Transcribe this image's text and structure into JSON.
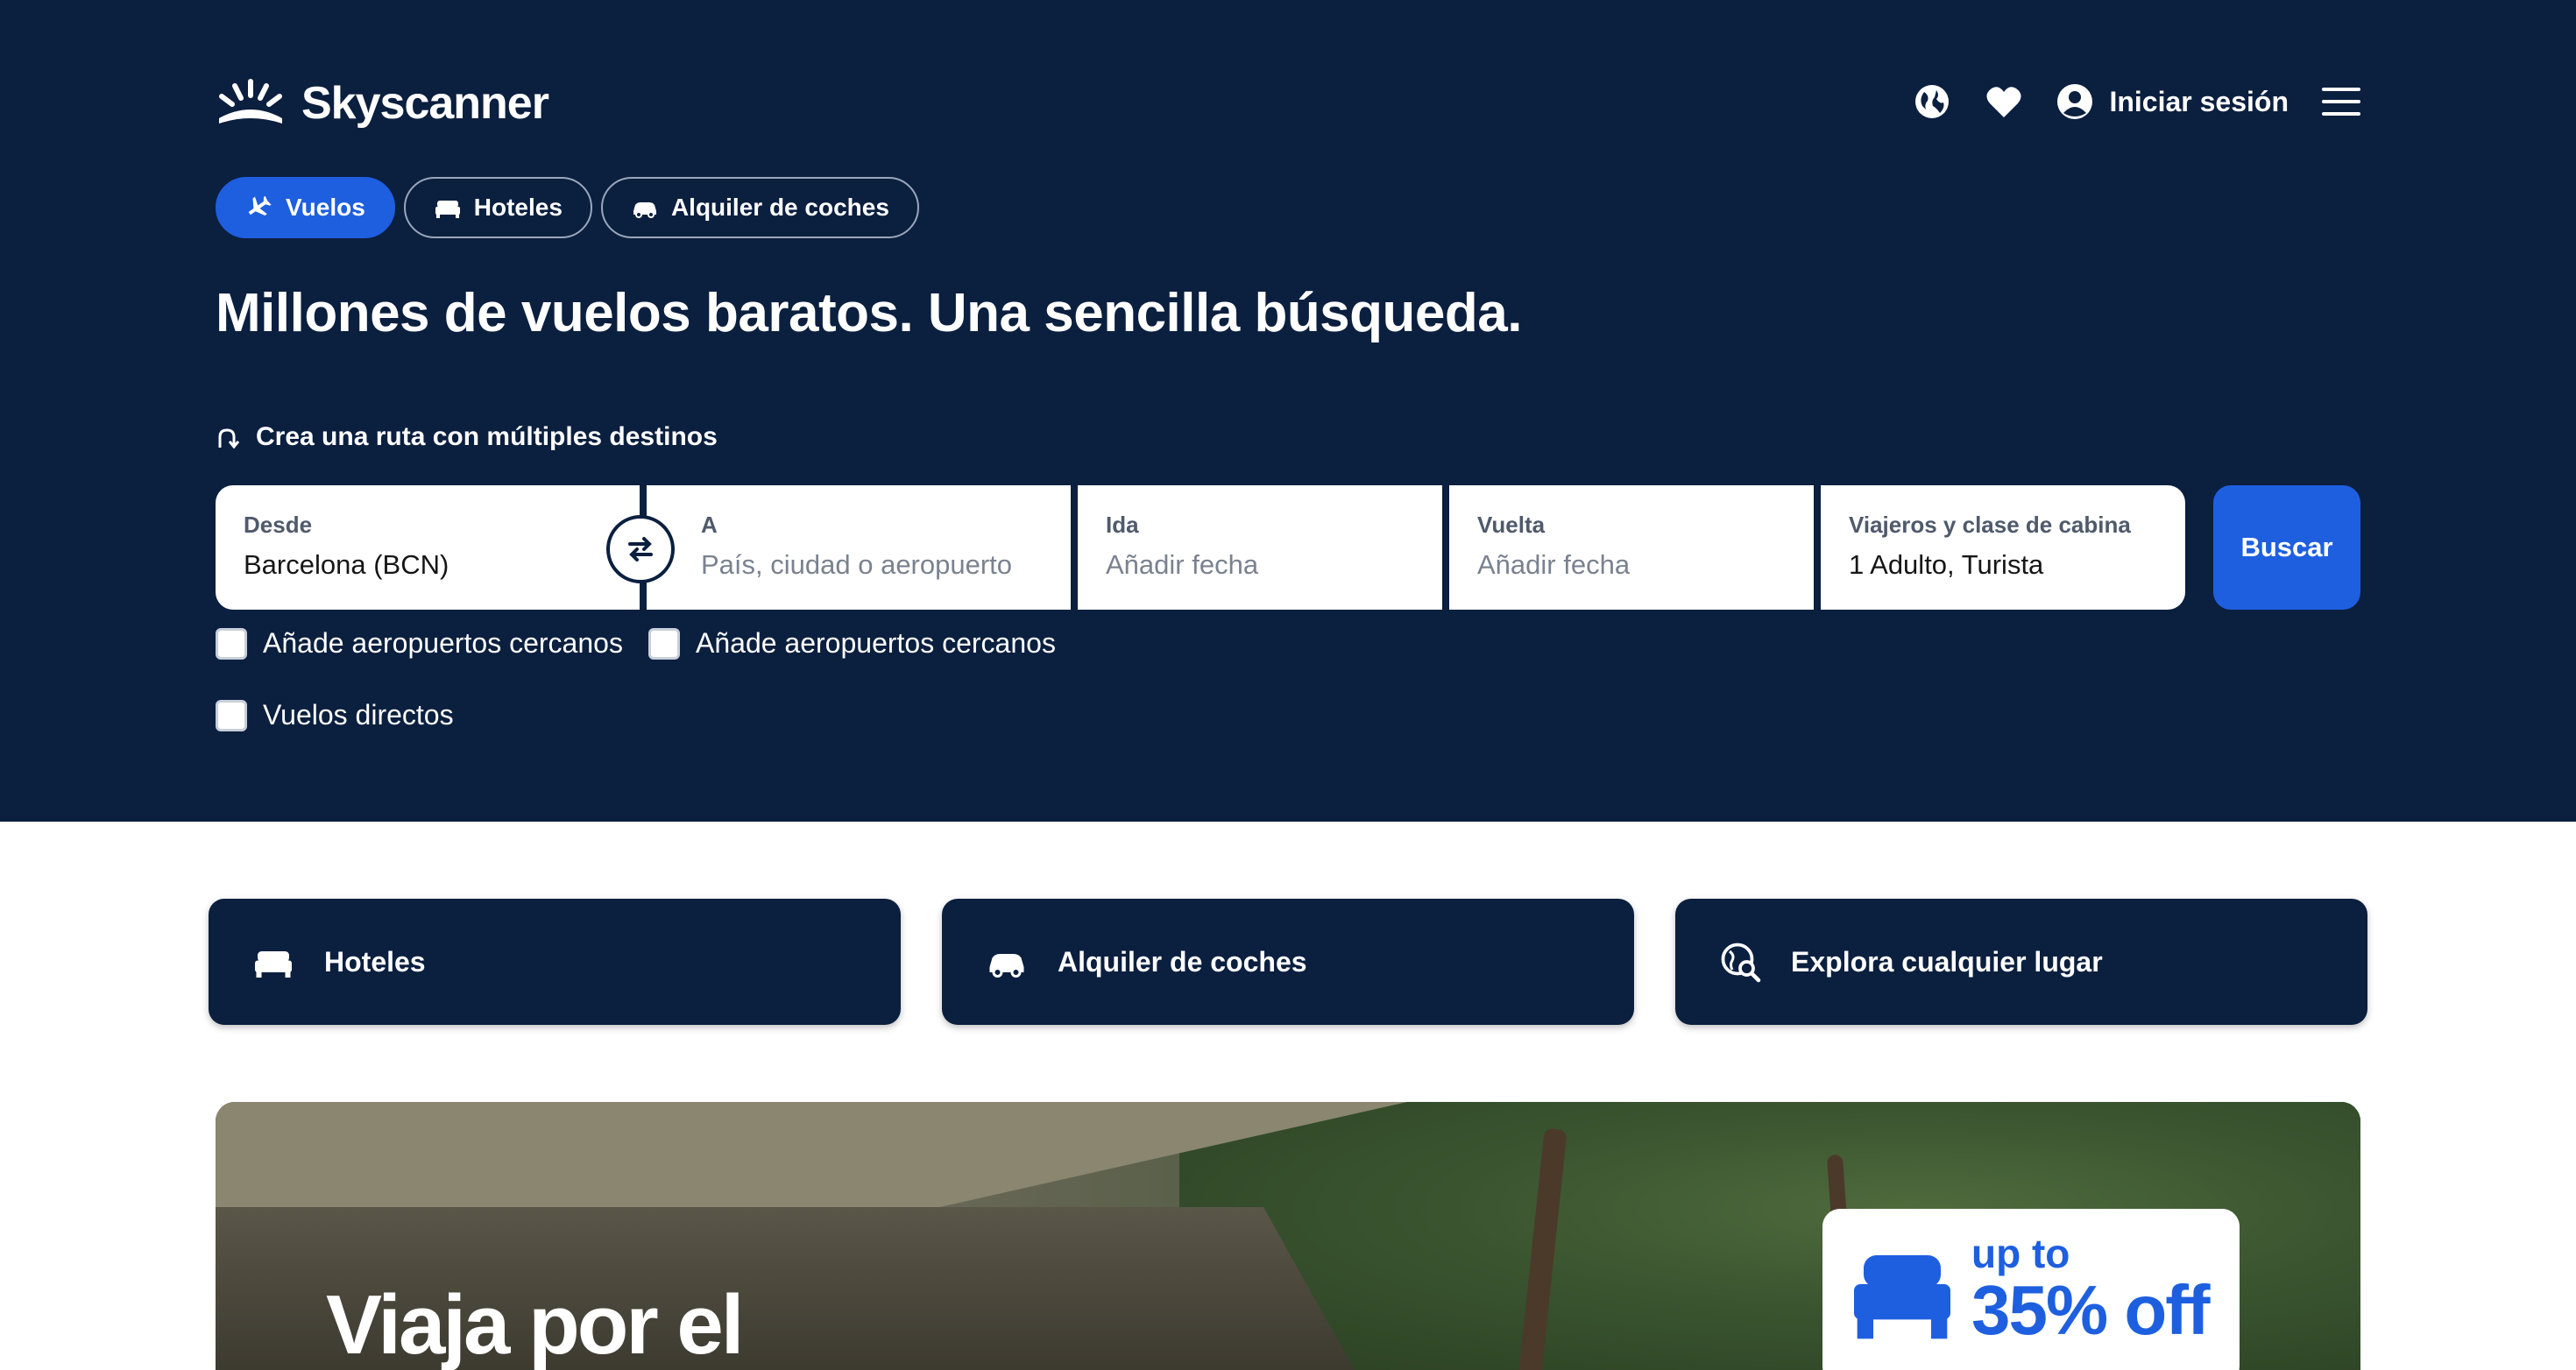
{
  "brand": {
    "name": "Skyscanner"
  },
  "header": {
    "login_label": "Iniciar sesión"
  },
  "tabs": [
    {
      "label": "Vuelos",
      "icon": "plane-icon",
      "active": true
    },
    {
      "label": "Hoteles",
      "icon": "bed-icon",
      "active": false
    },
    {
      "label": "Alquiler de coches",
      "icon": "car-icon",
      "active": false
    }
  ],
  "headline": "Millones de vuelos baratos. Una sencilla búsqueda.",
  "multi_city_label": "Crea una ruta con múltiples destinos",
  "search": {
    "from": {
      "label": "Desde",
      "value": "Barcelona (BCN)"
    },
    "to": {
      "label": "A",
      "placeholder": "País, ciudad o aeropuerto"
    },
    "depart": {
      "label": "Ida",
      "placeholder": "Añadir fecha"
    },
    "return": {
      "label": "Vuelta",
      "placeholder": "Añadir fecha"
    },
    "travellers": {
      "label": "Viajeros y clase de cabina",
      "value": "1 Adulto, Turista"
    },
    "button_label": "Buscar"
  },
  "options": {
    "nearby_from": "Añade aeropuertos cercanos",
    "nearby_to": "Añade aeropuertos cercanos",
    "direct": "Vuelos directos"
  },
  "quick_links": [
    {
      "label": "Hoteles",
      "icon": "bed-icon"
    },
    {
      "label": "Alquiler de coches",
      "icon": "car-icon"
    },
    {
      "label": "Explora cualquier lugar",
      "icon": "globe-search-icon"
    }
  ],
  "banner": {
    "title": "Viaja por el",
    "promo_prefix": "up to",
    "promo_value": "35% off"
  },
  "colors": {
    "hero_bg": "#0b1f3f",
    "accent": "#1e5fe0"
  }
}
